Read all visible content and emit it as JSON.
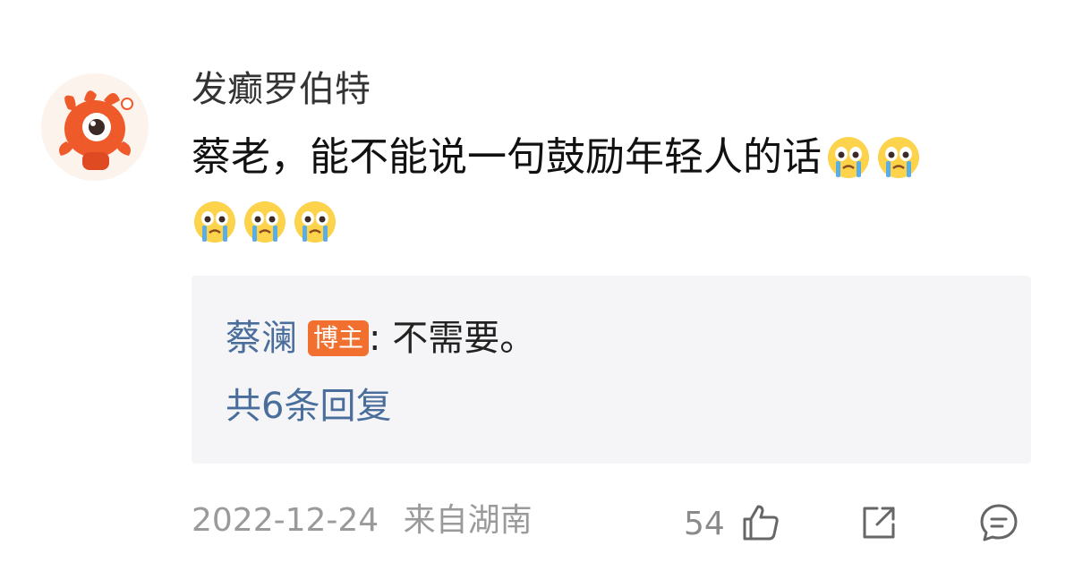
{
  "comment": {
    "username": "发癫罗伯特",
    "avatar_icon": "mascot-avatar-icon",
    "text_line1": "蔡老，能不能说一句鼓励年轻人的话",
    "emoji_icon": "crying-face-emoji",
    "emoji_count_line1": 2,
    "emoji_count_line2": 3
  },
  "reply": {
    "author": "蔡澜",
    "badge": "博主",
    "text": ": 不需要。",
    "more_link": "共6条回复"
  },
  "footer": {
    "date": "2022-12-24",
    "location": "来自湖南",
    "like_count": "54",
    "like_icon": "thumbs-up-icon",
    "share_icon": "share-icon",
    "comment_icon": "comment-icon"
  },
  "colors": {
    "link_blue": "#4a6e9c",
    "badge_orange": "#f2702f",
    "reply_bg": "#f5f5f7",
    "meta_gray": "#9a9a9a"
  }
}
